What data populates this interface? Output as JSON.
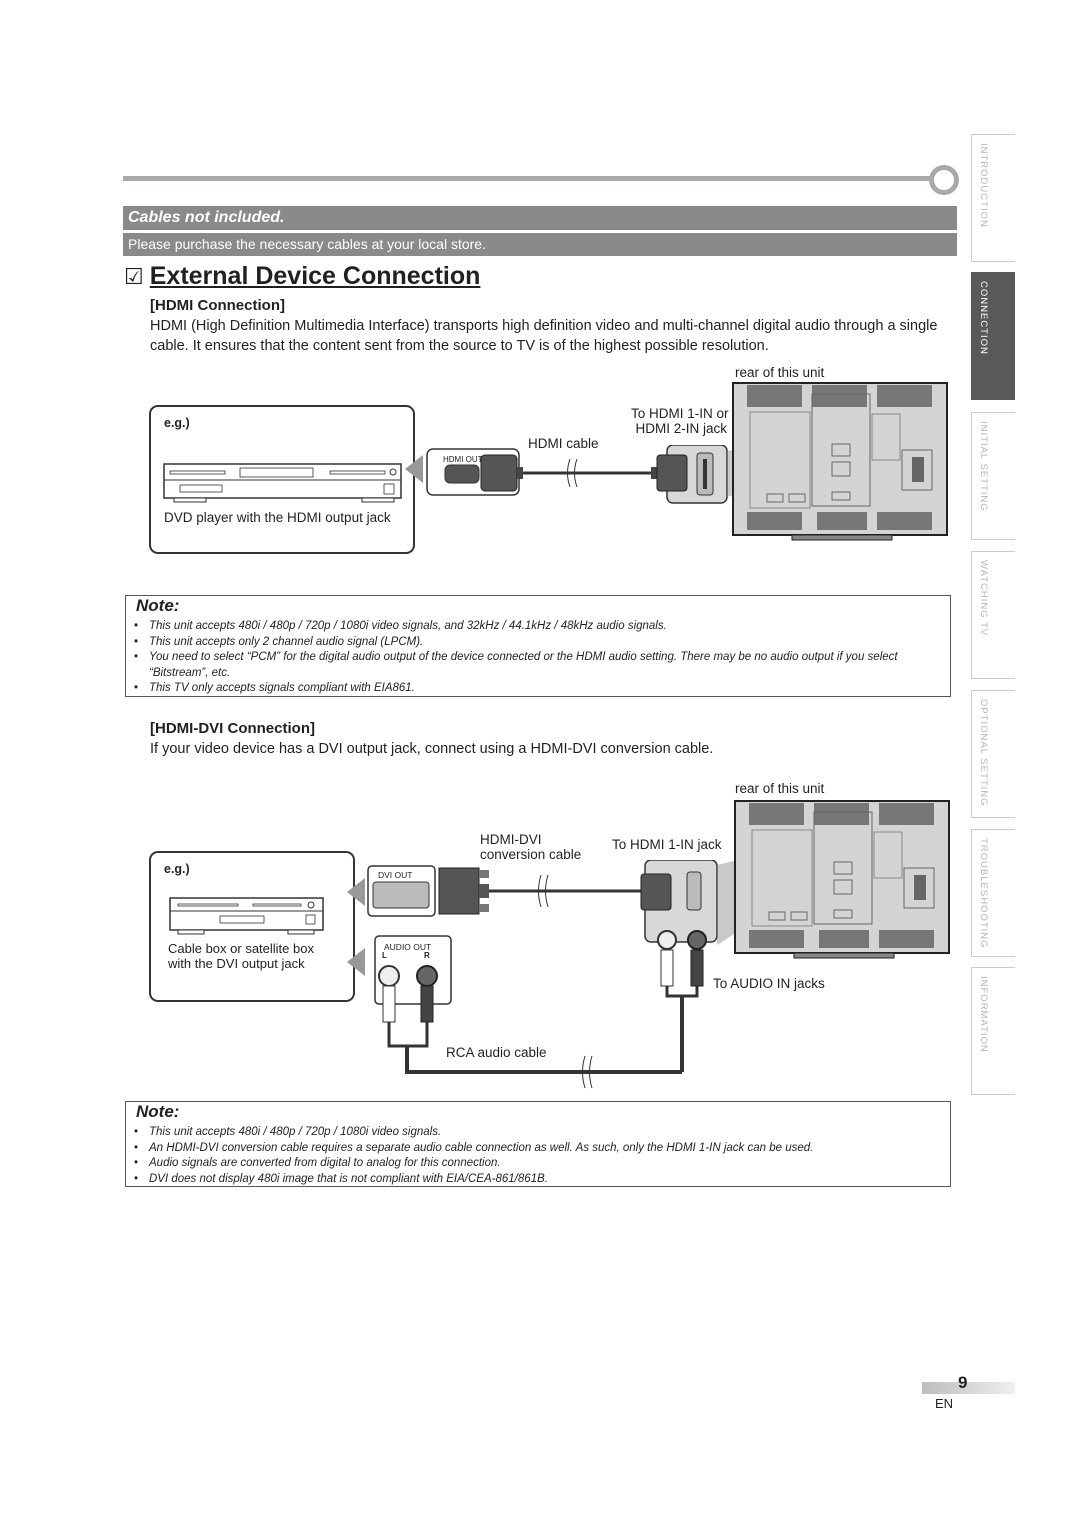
{
  "banner": {
    "title": "Cables not included.",
    "subtitle": "Please purchase the necessary cables at your local store."
  },
  "page_title": {
    "check_glyph": "☑",
    "text": "External Device Connection"
  },
  "side_tabs": [
    {
      "label": "INTRODUCTION",
      "active": false
    },
    {
      "label": "CONNECTION",
      "active": true
    },
    {
      "label": "INITIAL  SETTING",
      "active": false
    },
    {
      "label": "WATCHING  TV",
      "active": false
    },
    {
      "label": "OPTIONAL  SETTING",
      "active": false
    },
    {
      "label": "TROUBLESHOOTING",
      "active": false
    },
    {
      "label": "INFORMATION",
      "active": false
    }
  ],
  "hdmi": {
    "heading": "[HDMI Connection]",
    "body": "HDMI (High Definition Multimedia Interface) transports high definition video and multi-channel digital audio through a single cable. It ensures that the content sent from the source to TV is of the highest possible resolution.",
    "diagram": {
      "eg": "e.g.)",
      "device_caption": "DVD player with the HDMI output jack",
      "port_label": "HDMI OUT",
      "cable_label": "HDMI cable",
      "jack_label_line1": "To HDMI 1-IN or",
      "jack_label_line2": "HDMI 2-IN jack",
      "rear_label": "rear of this unit"
    },
    "notes": {
      "title": "Note:",
      "items": [
        "This unit accepts 480i / 480p / 720p / 1080i video signals, and 32kHz / 44.1kHz / 48kHz audio signals.",
        "This unit accepts only 2 channel audio signal (LPCM).",
        "You need to select “PCM” for the digital audio output of the device connected or the HDMI audio setting. There may be no audio output if you select “Bitstream”, etc.",
        "This TV only accepts signals compliant with EIA861."
      ]
    }
  },
  "hdmi_dvi": {
    "heading": "[HDMI-DVI Connection]",
    "body": "If your video device has a DVI output jack, connect using a HDMI-DVI conversion cable.",
    "diagram": {
      "eg": "e.g.)",
      "device_caption_line1": "Cable box or satellite box",
      "device_caption_line2": "with the DVI output jack",
      "dvi_port_label": "DVI OUT",
      "audio_port_label": "AUDIO OUT",
      "audio_left": "L",
      "audio_right": "R",
      "cable_label_line1": "HDMI-DVI",
      "cable_label_line2": "conversion cable",
      "jack_label": "To HDMI 1-IN jack",
      "audio_in_label": "To AUDIO IN jacks",
      "rca_label": "RCA audio cable",
      "rear_label": "rear of this unit"
    },
    "notes": {
      "title": "Note:",
      "items": [
        "This unit accepts 480i / 480p / 720p / 1080i video signals.",
        "An HDMI-DVI conversion cable requires a separate audio cable connection as well. As such, only the HDMI 1-IN jack can be used.",
        "Audio signals are converted from digital to analog for this connection.",
        "DVI does not display 480i image that is not compliant with EIA/CEA-861/861B."
      ]
    }
  },
  "footer": {
    "page_number": "9",
    "language": "EN"
  }
}
